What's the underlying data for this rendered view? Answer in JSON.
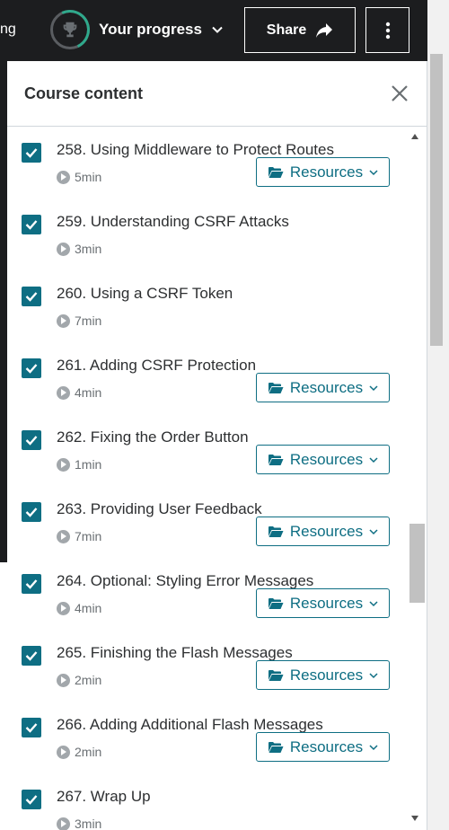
{
  "topbar": {
    "fragment_text": "ng",
    "progress_label": "Your progress",
    "share_label": "Share"
  },
  "panel": {
    "title": "Course content"
  },
  "lectures": [
    {
      "title": "258. Using Middleware to Protect Routes",
      "duration": "5min",
      "resources": "Resources",
      "has_resources": true,
      "completed": true
    },
    {
      "title": "259. Understanding CSRF Attacks",
      "duration": "3min",
      "resources": "",
      "has_resources": false,
      "completed": true
    },
    {
      "title": "260. Using a CSRF Token",
      "duration": "7min",
      "resources": "",
      "has_resources": false,
      "completed": true
    },
    {
      "title": "261. Adding CSRF Protection",
      "duration": "4min",
      "resources": "Resources",
      "has_resources": true,
      "completed": true
    },
    {
      "title": "262. Fixing the Order Button",
      "duration": "1min",
      "resources": "Resources",
      "has_resources": true,
      "completed": true
    },
    {
      "title": "263. Providing User Feedback",
      "duration": "7min",
      "resources": "Resources",
      "has_resources": true,
      "completed": true
    },
    {
      "title": "264. Optional: Styling Error Messages",
      "duration": "4min",
      "resources": "Resources",
      "has_resources": true,
      "completed": true
    },
    {
      "title": "265. Finishing the Flash Messages",
      "duration": "2min",
      "resources": "Resources",
      "has_resources": true,
      "completed": true
    },
    {
      "title": "266. Adding Additional Flash Messages",
      "duration": "2min",
      "resources": "Resources",
      "has_resources": true,
      "completed": true
    },
    {
      "title": "267. Wrap Up",
      "duration": "3min",
      "resources": "",
      "has_resources": false,
      "completed": true
    }
  ],
  "colors": {
    "accent": "#0e6e83",
    "topbar_bg": "#1c1d1f",
    "progress_ring": "#2fa98c"
  }
}
